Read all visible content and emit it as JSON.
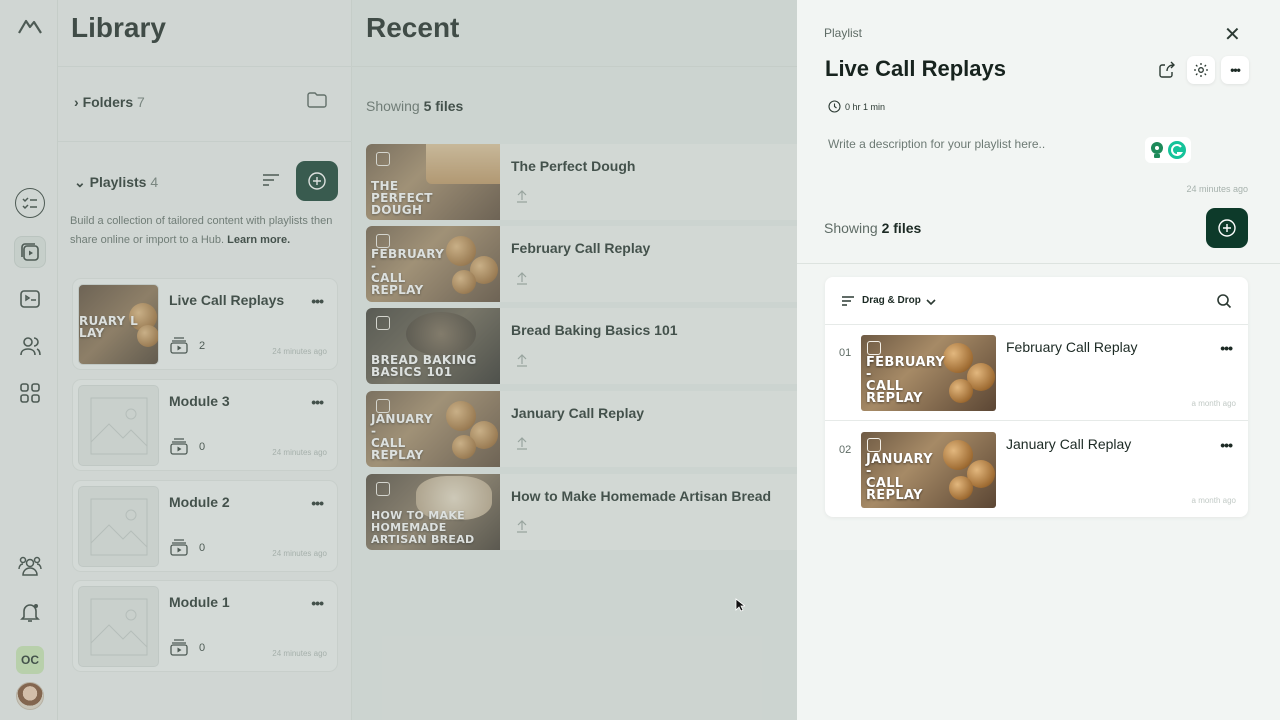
{
  "library": {
    "title": "Library",
    "folders": {
      "label": "Folders",
      "count": "7"
    },
    "playlists": {
      "label": "Playlists",
      "count": "4",
      "desc": "Build a collection of tailored content with playlists then share online or import to a Hub.",
      "learn_more": "Learn more."
    },
    "cards": [
      {
        "title": "Live Call Replays",
        "count": "2",
        "ago": "24 minutes ago",
        "thumb": "RUARY L LAY"
      },
      {
        "title": "Module 3",
        "count": "0",
        "ago": "24 minutes ago"
      },
      {
        "title": "Module 2",
        "count": "0",
        "ago": "24 minutes ago"
      },
      {
        "title": "Module 1",
        "count": "0",
        "ago": "24 minutes ago"
      }
    ]
  },
  "recent": {
    "title": "Recent",
    "showing_prefix": "Showing",
    "showing_count": "5 files",
    "files": [
      {
        "title": "The Perfect Dough",
        "thumb": [
          "THE",
          "PERFECT",
          "DOUGH"
        ]
      },
      {
        "title": "February Call Replay",
        "thumb": [
          "FEBRUARY",
          "-",
          "CALL",
          "REPLAY"
        ]
      },
      {
        "title": "Bread Baking Basics 101",
        "thumb": [
          "BREAD BAKING",
          "BASICS 101"
        ]
      },
      {
        "title": "January Call Replay",
        "thumb": [
          "JANUARY",
          "-",
          "CALL",
          "REPLAY"
        ]
      },
      {
        "title": "How to Make Homemade Artisan Bread",
        "thumb": [
          "HOW TO MAKE",
          "HOMEMADE",
          "ARTISAN BREAD"
        ]
      }
    ]
  },
  "panel": {
    "crumb": "Playlist",
    "title": "Live Call Replays",
    "duration": "0 hr 1 min",
    "desc_placeholder": "Write a description for your playlist here..",
    "ago": "24 minutes ago",
    "showing_prefix": "Showing",
    "showing_count": "2 files",
    "sort_label": "Drag & Drop",
    "items": [
      {
        "num": "01",
        "title": "February Call Replay",
        "ago": "a month ago",
        "thumb": [
          "FEBRUARY",
          "-",
          "CALL",
          "REPLAY"
        ]
      },
      {
        "num": "02",
        "title": "January Call Replay",
        "ago": "a month ago",
        "thumb": [
          "JANUARY",
          "-",
          "CALL",
          "REPLAY"
        ]
      }
    ]
  },
  "user": {
    "initials": "OC"
  },
  "colors": {
    "brand": "#0d3a2a",
    "accent_badge": "#c9e8b4"
  }
}
